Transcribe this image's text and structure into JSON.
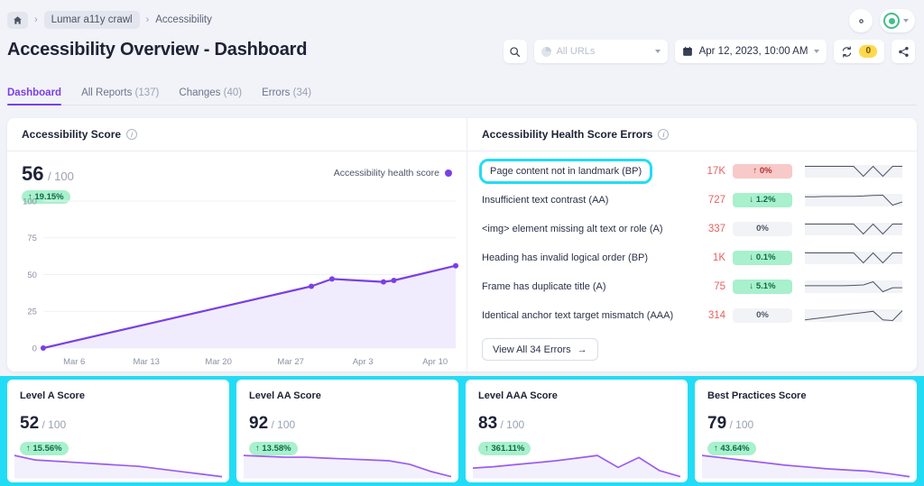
{
  "breadcrumb": {
    "home_icon": "home-icon",
    "project": "Lumar a11y crawl",
    "current": "Accessibility"
  },
  "header": {
    "title": "Accessibility Overview - Dashboard",
    "gear_icon": "gear-icon",
    "avatar_icon": "user-avatar-icon",
    "avatar_chevron": "chevron-down-icon"
  },
  "toolbar": {
    "search_icon": "search-icon",
    "url_filter_placeholder": "All URLs",
    "url_filter_icon": "segment-donut-icon",
    "date_icon": "calendar-icon",
    "date_value": "Apr 12, 2023, 10:00 AM",
    "refresh_icon": "refresh-icon",
    "refresh_badge": "0",
    "share_icon": "share-icon"
  },
  "tabs": [
    {
      "label": "Dashboard",
      "count": "",
      "active": true
    },
    {
      "label": "All Reports",
      "count": "(137)",
      "active": false
    },
    {
      "label": "Changes",
      "count": "(40)",
      "active": false
    },
    {
      "label": "Errors",
      "count": "(34)",
      "active": false
    }
  ],
  "score_panel": {
    "title": "Accessibility Score",
    "info_icon": "info-icon",
    "score": "56",
    "denominator": "/ 100",
    "delta": "↑ 19.15%",
    "legend_label": "Accessibility health score",
    "legend_color": "#7b3fe4"
  },
  "errors_panel": {
    "title": "Accessibility Health Score Errors",
    "info_icon": "info-icon",
    "view_all_label": "View All 34 Errors",
    "view_all_icon": "arrow-right-icon",
    "rows": [
      {
        "name": "Page content not in landmark (BP)",
        "count": "17K",
        "delta": "↑ 0%",
        "delta_type": "bad",
        "highlighted": true
      },
      {
        "name": "Insufficient text contrast (AA)",
        "count": "727",
        "delta": "↓ 1.2%",
        "delta_type": "good",
        "highlighted": false
      },
      {
        "name": "<img> element missing alt text or role (A)",
        "count": "337",
        "delta": "0%",
        "delta_type": "neutral",
        "highlighted": false
      },
      {
        "name": "Heading has invalid logical order (BP)",
        "count": "1K",
        "delta": "↓ 0.1%",
        "delta_type": "good",
        "highlighted": false
      },
      {
        "name": "Frame has duplicate title (A)",
        "count": "75",
        "delta": "↓ 5.1%",
        "delta_type": "good",
        "highlighted": false
      },
      {
        "name": "Identical anchor text target mismatch (AAA)",
        "count": "314",
        "delta": "0%",
        "delta_type": "neutral",
        "highlighted": false
      }
    ]
  },
  "cards": [
    {
      "title": "Level A Score",
      "score": "52",
      "denominator": "/ 100",
      "delta": "↑ 15.56%"
    },
    {
      "title": "Level AA Score",
      "score": "92",
      "denominator": "/ 100",
      "delta": "↑ 13.58%"
    },
    {
      "title": "Level AAA Score",
      "score": "83",
      "denominator": "/ 100",
      "delta": "↑ 361.11%"
    },
    {
      "title": "Best Practices Score",
      "score": "79",
      "denominator": "/ 100",
      "delta": "↑ 43.64%"
    }
  ],
  "chart_data": {
    "type": "line",
    "title": "Accessibility Score",
    "xlabel": "",
    "ylabel": "",
    "ylim": [
      0,
      100
    ],
    "yticks": [
      0,
      25,
      50,
      75,
      100
    ],
    "xticks": [
      "Mar 6",
      "Mar 13",
      "Mar 20",
      "Mar 27",
      "Apr 3",
      "Apr 10"
    ],
    "grid": true,
    "legend": [
      "Accessibility health score"
    ],
    "legend_position": "top-right",
    "series": [
      {
        "name": "Accessibility health score",
        "color": "#7b3fe4",
        "area_fill": "#f0ecfd",
        "points": [
          {
            "x": "Mar 3",
            "y": 0
          },
          {
            "x": "Mar 29",
            "y": 42
          },
          {
            "x": "Mar 31",
            "y": 47
          },
          {
            "x": "Apr 5",
            "y": 45
          },
          {
            "x": "Apr 6",
            "y": 46
          },
          {
            "x": "Apr 12",
            "y": 56
          }
        ]
      }
    ]
  },
  "sparklines": {
    "errors": [
      [
        50,
        50,
        50,
        50,
        50,
        50,
        48,
        50,
        48,
        50,
        50
      ],
      [
        50,
        50,
        51,
        51,
        52,
        52,
        53,
        55,
        56,
        18,
        30
      ],
      [
        50,
        50,
        50,
        50,
        50,
        50,
        48,
        50,
        48,
        50,
        50
      ],
      [
        50,
        50,
        50,
        50,
        50,
        50,
        48,
        50,
        48,
        50,
        50
      ],
      [
        50,
        50,
        50,
        50,
        50,
        51,
        52,
        60,
        35,
        45,
        45
      ],
      [
        30,
        34,
        38,
        42,
        46,
        50,
        54,
        58,
        30,
        28,
        60
      ]
    ],
    "cards": [
      [
        95,
        88,
        86,
        84,
        82,
        80,
        78,
        74,
        70,
        66,
        62
      ],
      [
        62,
        61,
        60,
        60,
        59,
        58,
        57,
        56,
        52,
        44,
        38
      ],
      [
        38,
        42,
        48,
        54,
        60,
        68,
        76,
        40,
        70,
        30,
        12
      ],
      [
        92,
        84,
        76,
        68,
        60,
        54,
        48,
        44,
        40,
        32,
        22
      ]
    ]
  }
}
